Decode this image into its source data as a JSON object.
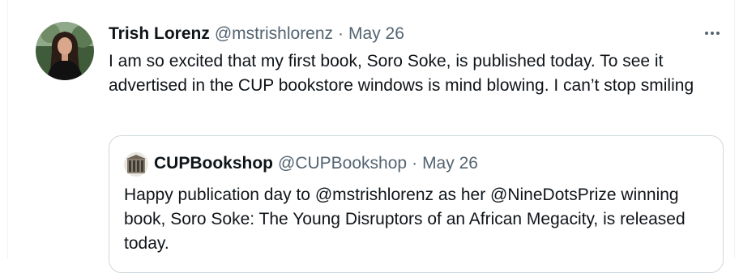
{
  "tweet": {
    "author": {
      "display_name": "Trish Lorenz",
      "handle": "@mstrishlorenz",
      "avatar_icon": "profile-photo"
    },
    "separator": "·",
    "date": "May 26",
    "more_icon": "more-horizontal-icon",
    "text": "I am so excited that my first book, Soro Soke, is published today. To see it advertised in the CUP bookstore windows is mind blowing. I can’t stop smiling"
  },
  "quoted_tweet": {
    "author": {
      "display_name": "CUPBookshop",
      "handle": "@CUPBookshop",
      "avatar_icon": "bookshop-logo"
    },
    "separator": "·",
    "date": "May 26",
    "text": "Happy publication day to @mstrishlorenz as her @NineDotsPrize winning book, Soro Soke: The Young Disruptors of an African Megacity, is released today."
  },
  "colors": {
    "text": "#0f1419",
    "muted": "#536471",
    "border": "#cfd9de"
  }
}
